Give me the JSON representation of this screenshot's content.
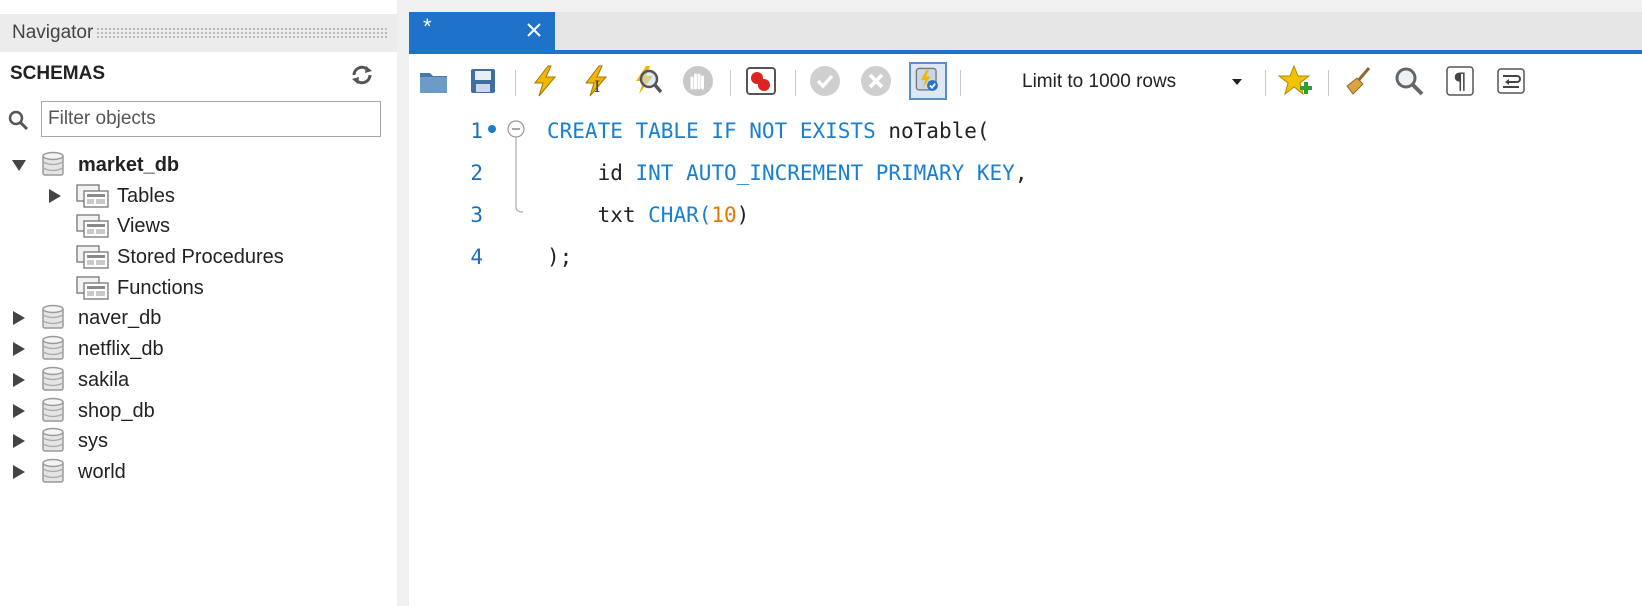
{
  "navigator": {
    "title": "Navigator",
    "schemas_label": "SCHEMAS",
    "filter_placeholder": "Filter objects",
    "databases": [
      {
        "name": "market_db",
        "expanded": true,
        "children": [
          "Tables",
          "Views",
          "Stored Procedures",
          "Functions"
        ]
      },
      {
        "name": "naver_db"
      },
      {
        "name": "netflix_db"
      },
      {
        "name": "sakila"
      },
      {
        "name": "shop_db"
      },
      {
        "name": "sys"
      },
      {
        "name": "world"
      }
    ]
  },
  "editor": {
    "tab_label": "*",
    "limit_option": "Limit to 1000 rows",
    "lines": [
      {
        "number": "1",
        "tokens": [
          [
            "kw",
            "CREATE TABLE IF NOT EXISTS "
          ],
          [
            "id",
            "noTable("
          ]
        ]
      },
      {
        "number": "2",
        "tokens": [
          [
            "plain",
            "    id "
          ],
          [
            "kw",
            "INT AUTO_INCREMENT PRIMARY KEY"
          ],
          [
            "plain",
            ","
          ]
        ]
      },
      {
        "number": "3",
        "tokens": [
          [
            "plain",
            "    txt "
          ],
          [
            "kw",
            "CHAR("
          ],
          [
            "num",
            "10"
          ],
          [
            "plain",
            ")"
          ]
        ]
      },
      {
        "number": "4",
        "tokens": [
          [
            "plain",
            ");"
          ]
        ]
      }
    ]
  },
  "colors": {
    "accent": "#1e72c8",
    "keyword": "#1a7fce",
    "number": "#e07b00",
    "line_number": "#1c6fb8"
  },
  "icons": [
    "refresh-icon",
    "search-icon",
    "open-file-icon",
    "save-icon",
    "execute-icon",
    "execute-current-icon",
    "explain-icon",
    "stop-icon",
    "toggle-error-icon",
    "commit-icon",
    "rollback-icon",
    "autocommit-icon",
    "add-snippet-icon",
    "beautify-icon",
    "find-icon",
    "invisible-chars-icon",
    "word-wrap-icon"
  ]
}
